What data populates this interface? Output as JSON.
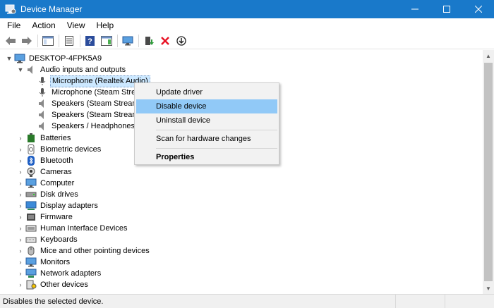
{
  "window": {
    "title": "Device Manager",
    "controls": [
      "minimize-icon",
      "maximize-icon",
      "close-icon"
    ]
  },
  "menubar": {
    "items": [
      "File",
      "Action",
      "View",
      "Help"
    ]
  },
  "toolbar": {
    "buttons": [
      "back-arrow-icon",
      "forward-arrow-icon",
      "properties-sheet-icon",
      "show-hide-console-tree-icon",
      "help-icon",
      "action-pane-icon",
      "monitor-scan-icon",
      "update-driver-icon",
      "uninstall-x-icon",
      "download-driver-icon"
    ]
  },
  "tree": {
    "root": "DESKTOP-4FPK5A9",
    "rows": [
      {
        "label": "DESKTOP-4FPK5A9",
        "icon": "computer-icon",
        "expander": "▼"
      },
      {
        "label": "Audio inputs and outputs",
        "icon": "speaker-icon",
        "expander": "▼"
      },
      {
        "label": "Microphone (Realtek Audio)",
        "icon": "microphone-icon",
        "expander": ""
      },
      {
        "label": "Microphone (Steam Streaming Microphone)",
        "icon": "microphone-icon",
        "expander": ""
      },
      {
        "label": "Speakers (Steam Streaming Microphone)",
        "icon": "speaker-icon",
        "expander": ""
      },
      {
        "label": "Speakers (Steam Streaming Speakers)",
        "icon": "speaker-icon",
        "expander": ""
      },
      {
        "label": "Speakers / Headphones (Realtek Audio)",
        "icon": "speaker-icon",
        "expander": ""
      },
      {
        "label": "Batteries",
        "icon": "battery-icon",
        "expander": "›"
      },
      {
        "label": "Biometric devices",
        "icon": "fingerprint-icon",
        "expander": "›"
      },
      {
        "label": "Bluetooth",
        "icon": "bluetooth-icon",
        "expander": "›"
      },
      {
        "label": "Cameras",
        "icon": "camera-icon",
        "expander": "›"
      },
      {
        "label": "Computer",
        "icon": "computer-icon",
        "expander": "›"
      },
      {
        "label": "Disk drives",
        "icon": "disk-drive-icon",
        "expander": "›"
      },
      {
        "label": "Display adapters",
        "icon": "display-adapter-icon",
        "expander": "›"
      },
      {
        "label": "Firmware",
        "icon": "firmware-icon",
        "expander": "›"
      },
      {
        "label": "Human Interface Devices",
        "icon": "hid-icon",
        "expander": "›"
      },
      {
        "label": "Keyboards",
        "icon": "keyboard-icon",
        "expander": "›"
      },
      {
        "label": "Mice and other pointing devices",
        "icon": "mouse-icon",
        "expander": "›"
      },
      {
        "label": "Monitors",
        "icon": "monitor-icon",
        "expander": "›"
      },
      {
        "label": "Network adapters",
        "icon": "network-adapter-icon",
        "expander": "›"
      },
      {
        "label": "Other devices",
        "icon": "other-devices-icon",
        "expander": "›"
      }
    ]
  },
  "context_menu": {
    "items": [
      {
        "label": "Update driver"
      },
      {
        "label": "Disable device"
      },
      {
        "label": "Uninstall device"
      },
      {
        "label": "Scan for hardware changes"
      },
      {
        "label": "Properties"
      }
    ]
  },
  "statusbar": {
    "text": "Disables the selected device."
  },
  "colors": {
    "titlebar": "#1979ca",
    "selection": "#cce8ff",
    "menu_hover": "#91c9f7"
  }
}
